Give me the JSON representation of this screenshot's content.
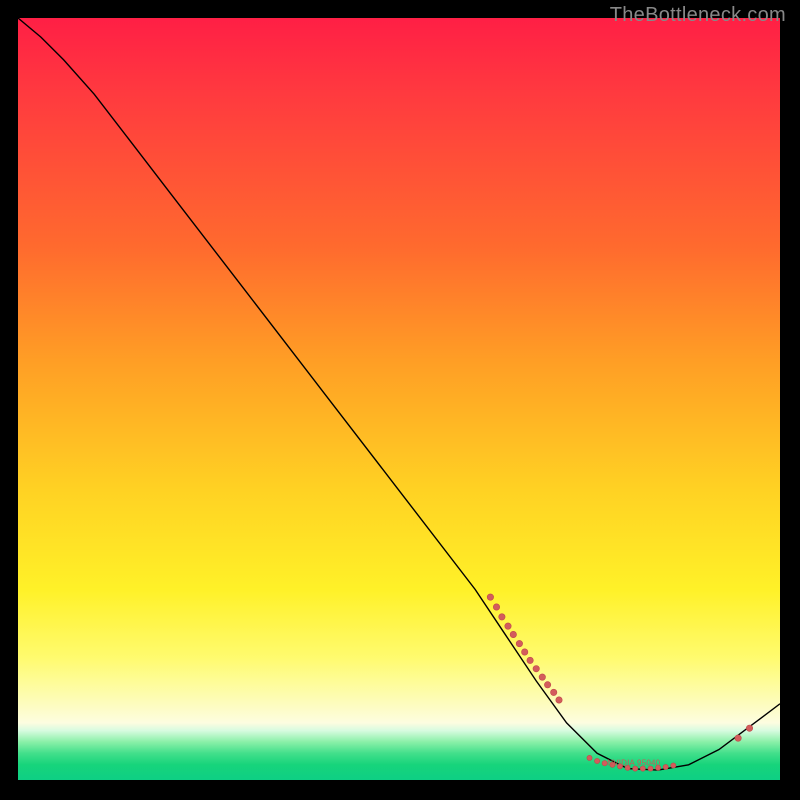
{
  "watermark": "TheBottleneck.com",
  "colors": {
    "dot": "#d35c5c",
    "curve": "#000000"
  },
  "chart_data": {
    "type": "line",
    "title": "",
    "xlabel": "",
    "ylabel": "",
    "xlim": [
      0,
      100
    ],
    "ylim": [
      0,
      100
    ],
    "grid": false,
    "curve": [
      {
        "x": 0,
        "y": 100
      },
      {
        "x": 3,
        "y": 97.5
      },
      {
        "x": 6,
        "y": 94.5
      },
      {
        "x": 10,
        "y": 90
      },
      {
        "x": 15,
        "y": 83.5
      },
      {
        "x": 20,
        "y": 77
      },
      {
        "x": 30,
        "y": 64
      },
      {
        "x": 40,
        "y": 51
      },
      {
        "x": 50,
        "y": 38
      },
      {
        "x": 60,
        "y": 25
      },
      {
        "x": 64,
        "y": 19
      },
      {
        "x": 68,
        "y": 13
      },
      {
        "x": 72,
        "y": 7.5
      },
      {
        "x": 76,
        "y": 3.5
      },
      {
        "x": 80,
        "y": 1.5
      },
      {
        "x": 84,
        "y": 1.3
      },
      {
        "x": 88,
        "y": 2.0
      },
      {
        "x": 92,
        "y": 4.0
      },
      {
        "x": 96,
        "y": 7.0
      },
      {
        "x": 100,
        "y": 10
      }
    ],
    "points_left_cluster": [
      {
        "x": 62,
        "y": 24
      },
      {
        "x": 62.8,
        "y": 22.7
      },
      {
        "x": 63.5,
        "y": 21.4
      },
      {
        "x": 64.3,
        "y": 20.2
      },
      {
        "x": 65.0,
        "y": 19.1
      },
      {
        "x": 65.8,
        "y": 17.9
      },
      {
        "x": 66.5,
        "y": 16.8
      },
      {
        "x": 67.2,
        "y": 15.7
      },
      {
        "x": 68.0,
        "y": 14.6
      },
      {
        "x": 68.8,
        "y": 13.5
      },
      {
        "x": 69.5,
        "y": 12.5
      },
      {
        "x": 70.3,
        "y": 11.5
      },
      {
        "x": 71.0,
        "y": 10.5
      }
    ],
    "points_bottom_cluster": [
      {
        "x": 75,
        "y": 2.9
      },
      {
        "x": 76,
        "y": 2.5
      },
      {
        "x": 77,
        "y": 2.2
      },
      {
        "x": 78,
        "y": 2.0
      },
      {
        "x": 79,
        "y": 1.8
      },
      {
        "x": 80,
        "y": 1.6
      },
      {
        "x": 81,
        "y": 1.5
      },
      {
        "x": 82,
        "y": 1.5
      },
      {
        "x": 83,
        "y": 1.5
      },
      {
        "x": 84,
        "y": 1.6
      },
      {
        "x": 85,
        "y": 1.7
      },
      {
        "x": 86,
        "y": 1.9
      }
    ],
    "points_right_pair": [
      {
        "x": 94.5,
        "y": 5.5
      },
      {
        "x": 96.0,
        "y": 6.8
      }
    ],
    "labeled_point": {
      "x": 81,
      "y": 1.5,
      "label": "NVIDIA 95040"
    }
  }
}
